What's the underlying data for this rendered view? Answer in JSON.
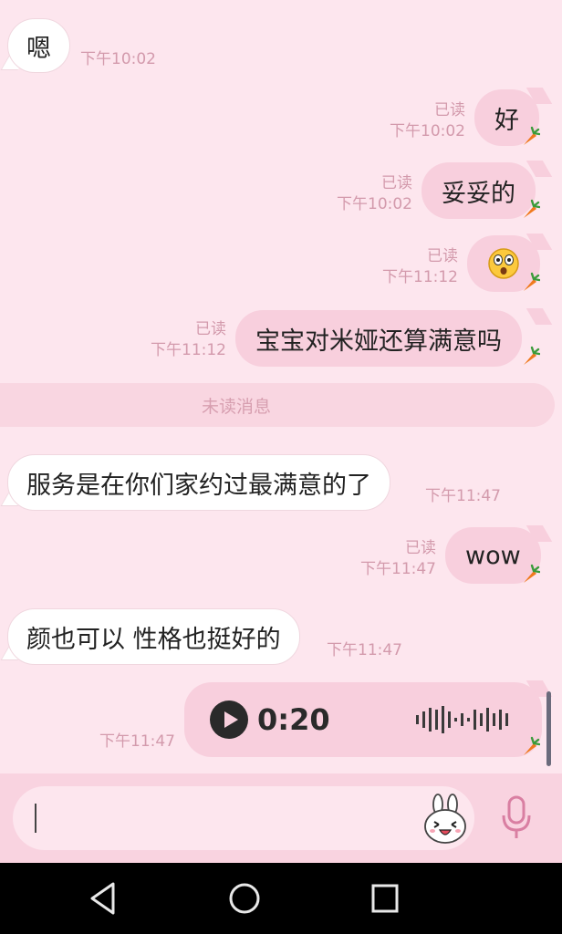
{
  "messages": [
    {
      "dir": "in",
      "text": "嗯",
      "time": "下午10:02"
    },
    {
      "dir": "out",
      "text": "好",
      "read": "已读",
      "time": "下午10:02"
    },
    {
      "dir": "out",
      "text": "妥妥的",
      "read": "已读",
      "time": "下午10:02"
    },
    {
      "dir": "out",
      "emoji": "shocked-face",
      "read": "已读",
      "time": "下午11:12"
    },
    {
      "dir": "out",
      "text": "宝宝对米娅还算满意吗",
      "read": "已读",
      "time": "下午11:12"
    },
    {
      "dir": "in",
      "text": "服务是在你们家约过最满意的了",
      "time": "下午11:47"
    },
    {
      "dir": "out",
      "text": "wow",
      "read": "已读",
      "time": "下午11:47"
    },
    {
      "dir": "in",
      "text": "颜也可以 性格也挺好的",
      "time": "下午11:47"
    },
    {
      "dir": "out",
      "voice_duration": "0:20",
      "time": "下午11:47"
    }
  ],
  "divider": "未读消息",
  "input": {
    "value": "",
    "sticker_icon": "bunny-sticker-icon",
    "mic_icon": "microphone-icon"
  },
  "colors": {
    "bg": "#fde6ee",
    "out_bubble": "#f8cfdd",
    "in_bubble": "#ffffff",
    "meta": "#d39aac"
  }
}
